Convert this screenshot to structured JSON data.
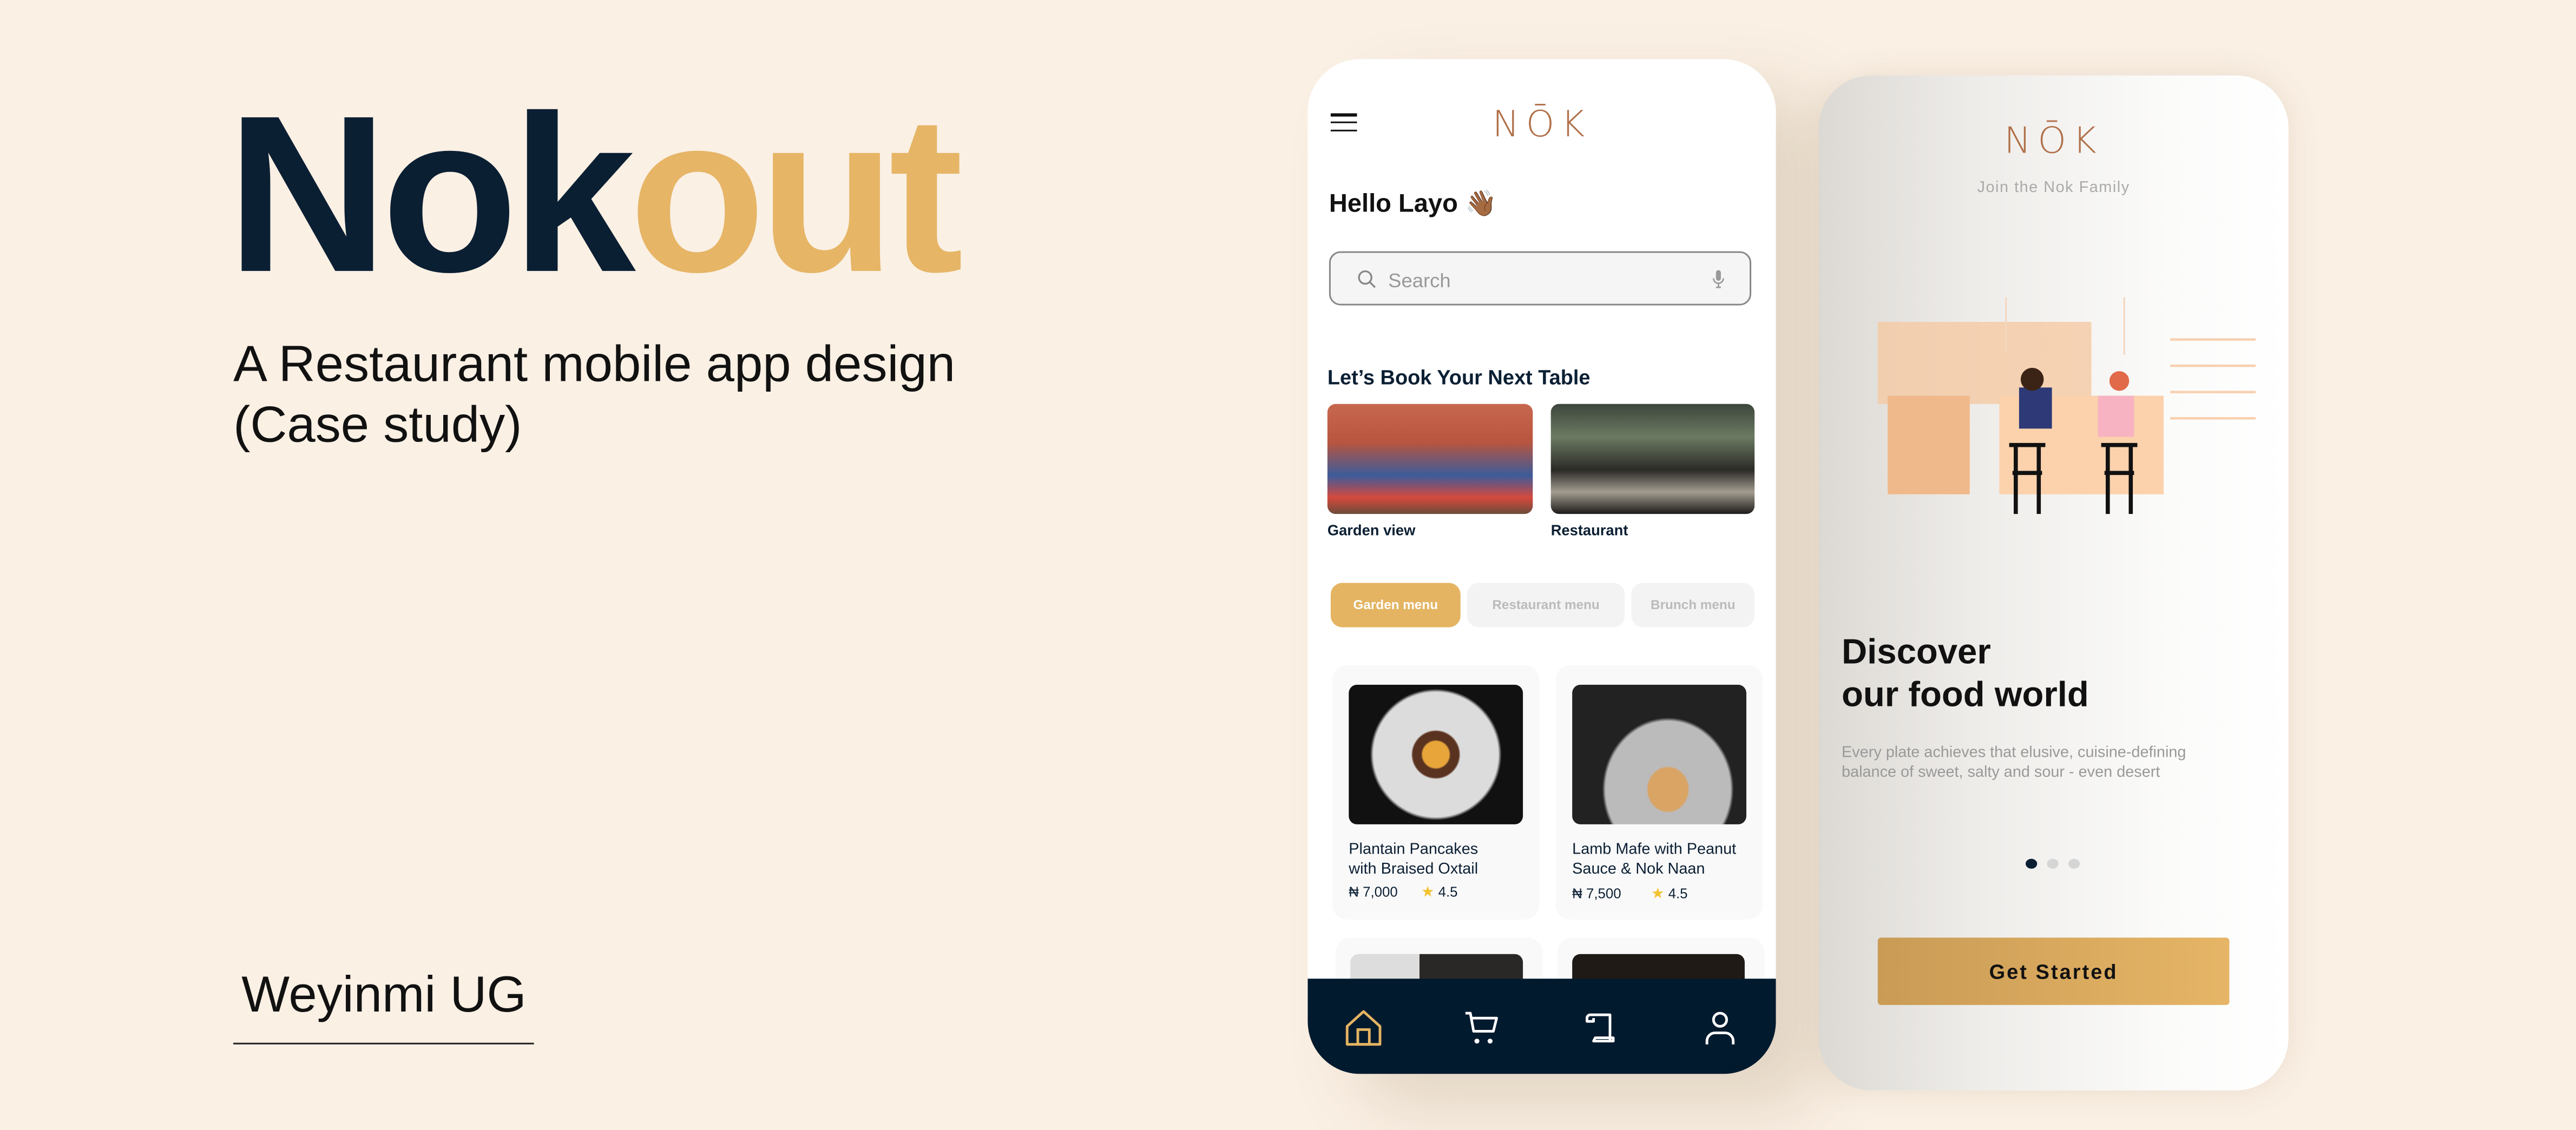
{
  "hero": {
    "title_dark": "Nok",
    "title_gold": "out",
    "subtitle_line1": "A Restaurant mobile app design",
    "subtitle_line2": "(Case study)",
    "author": "Weyinmi UG"
  },
  "colors": {
    "background": "#faf0e4",
    "navy": "#0b1f33",
    "gold": "#e6b566",
    "logo": "#b07049"
  },
  "home": {
    "logo": "NŌK",
    "greeting": "Hello Layo",
    "greeting_emoji": "👋🏾",
    "search_placeholder": "Search",
    "section_title": "Let’s Book Your Next Table",
    "venues": [
      {
        "label": "Garden view"
      },
      {
        "label": "Restaurant"
      }
    ],
    "menu_tabs": [
      {
        "label": "Garden menu",
        "active": true
      },
      {
        "label": "Restaurant menu",
        "active": false
      },
      {
        "label": "Brunch menu",
        "active": false
      }
    ],
    "dishes": [
      {
        "name_line1": "Plantain Pancakes",
        "name_line2": "with Braised Oxtail",
        "price": "₦ 7,000",
        "rating": "4.5"
      },
      {
        "name_line1": "Lamb Mafe with Peanut",
        "name_line2": "Sauce & Nok Naan",
        "price": "₦ 7,500",
        "rating": "4.5"
      }
    ],
    "nav_items": [
      "home-icon",
      "cart-icon",
      "scroll-icon",
      "profile-icon"
    ]
  },
  "onboarding": {
    "logo": "NŌK",
    "tagline": "Join the Nok Family",
    "heading_line1": "Discover",
    "heading_line2": "our food world",
    "description": "Every plate achieves that elusive, cuisine-defining balance of sweet, salty and sour - even desert",
    "page_index": 1,
    "page_count": 3,
    "cta": "Get Started"
  }
}
